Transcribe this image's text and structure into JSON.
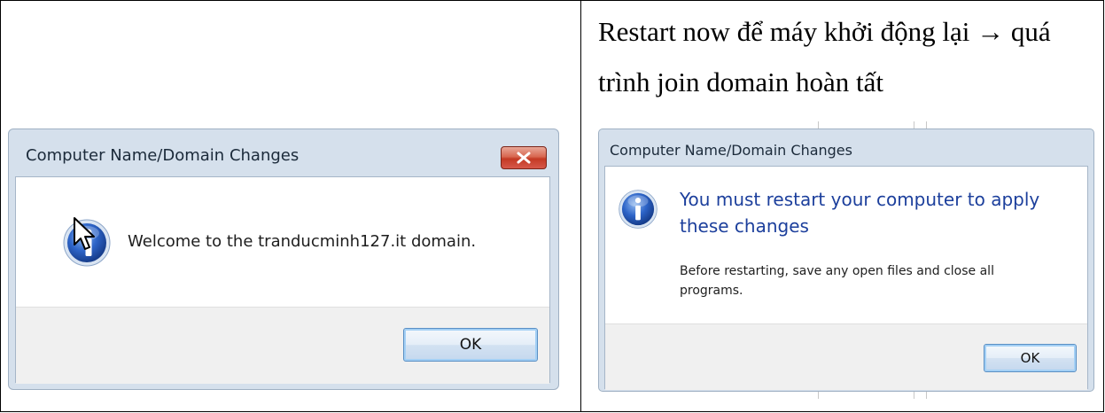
{
  "document": {
    "instruction_text": "Restart now để máy khởi động lại → quá trình join domain hoàn tất"
  },
  "welcome_dialog": {
    "title": "Computer Name/Domain Changes",
    "message": "Welcome to the tranducminh127.it domain.",
    "ok_label": "OK",
    "icon": "info-icon",
    "close_icon": "close-icon",
    "pointer_icon": "mouse-pointer-icon"
  },
  "restart_dialog": {
    "title": "Computer Name/Domain Changes",
    "main_instruction": "You must restart your computer to apply these changes",
    "detail": "Before restarting, save any open files and close all programs.",
    "ok_label": "OK",
    "icon": "info-icon"
  },
  "colors": {
    "frame": "#d5e0ec",
    "main_instruction": "#1c3f9c",
    "close_button": "#c43a24",
    "button_focus": "#5a8fc4"
  }
}
